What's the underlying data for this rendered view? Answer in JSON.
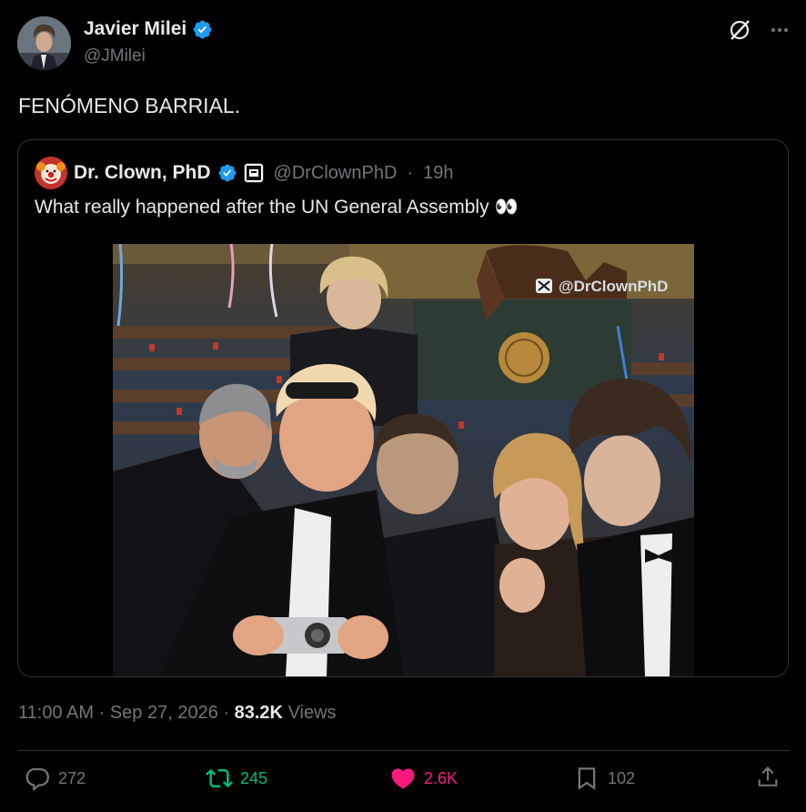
{
  "author": {
    "name": "Javier Milei",
    "handle": "@JMilei",
    "verified": true,
    "icons": [
      "verified-badge-icon",
      "grok-icon",
      "more-options-icon"
    ]
  },
  "tweet": {
    "text": "FENÓMENO BARRIAL."
  },
  "quoted": {
    "name": "Dr. Clown, PhD",
    "handle": "@DrClownPhD",
    "separator": "·",
    "time": "19h",
    "text": "What really happened after the UN General Assembly",
    "emoji": "👀",
    "image_watermark": "@DrClownPhD"
  },
  "meta": {
    "time": "11:00 AM",
    "separator1": "·",
    "date": "Sep 27, 2026",
    "separator2": "·",
    "views_count": "83.2K",
    "views_label": "Views"
  },
  "actions": {
    "replies": "272",
    "reposts": "245",
    "likes": "2.6K",
    "bookmarks": "102"
  },
  "colors": {
    "background": "#000000",
    "text": "#e7e9ea",
    "muted": "#71767b",
    "verified": "#1d9bf0",
    "repost_active": "#00ba7c",
    "like_active": "#f91880",
    "border": "#2f3336"
  }
}
